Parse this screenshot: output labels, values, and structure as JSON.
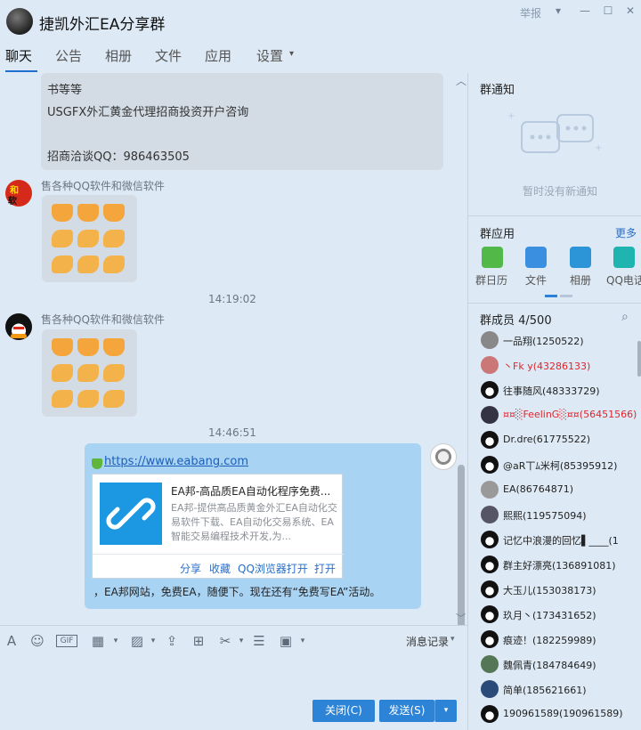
{
  "window": {
    "title": "捷凯外汇EA分享群",
    "report": "举报"
  },
  "tabs": [
    "聊天",
    "公告",
    "相册",
    "文件",
    "应用",
    "设置"
  ],
  "messages": {
    "first_bubble_lines": [
      "书等等",
      "USGFX外汇黄金代理招商投资开户咨询",
      "",
      "招商洽谈QQ：986463505"
    ],
    "sender1": "售各种QQ软件和微信软件",
    "time1": "14:19:02",
    "sender2": "售各种QQ软件和微信软件",
    "time2": "14:46:51",
    "link": "https://www.eabang.com",
    "card_title": "EA邦-高品质EA自动化程序免费...",
    "card_desc": "EA邦-提供高品质黄金外汇EA自动化交易软件下载、EA自动化交易系统、EA智能交易编程技术开发,为...",
    "card_actions": [
      "分享",
      "收藏",
      "QQ浏览器打开",
      "打开"
    ],
    "bubble_text": "，EA邦网站，免费EA，随便下。现在还有“免费写EA”活动。"
  },
  "toolbar": {
    "history": "消息记录"
  },
  "buttons": {
    "close": "关闭(C)",
    "send": "发送(S)"
  },
  "side": {
    "notice_title": "群通知",
    "notice_empty": "暂时没有新通知",
    "apps_title": "群应用",
    "apps_more": "更多",
    "apps": [
      "群日历",
      "文件",
      "相册",
      "QQ电话"
    ],
    "members_title": "群成员 4/500",
    "members": [
      {
        "name": "一品翔(1250522)",
        "red": false
      },
      {
        "name": "丶Fk y(43286133)",
        "red": true
      },
      {
        "name": "往事随风(48333729)",
        "red": false
      },
      {
        "name": "¤¤░FeelinG░¤¤(56451566)",
        "red": true
      },
      {
        "name": "Dr.dre(61775522)",
        "red": false
      },
      {
        "name": "@aR丅ﾑ米柯(85395912)",
        "red": false
      },
      {
        "name": "EA(86764871)",
        "red": false
      },
      {
        "name": "熙熙(119575094)",
        "red": false
      },
      {
        "name": "记忆中浪漫的回忆▌____(1",
        "red": false
      },
      {
        "name": "群主好漂亮(136891081)",
        "red": false
      },
      {
        "name": "大玉儿(153038173)",
        "red": false
      },
      {
        "name": "玖月丶(173431652)",
        "red": false
      },
      {
        "name": "痕迹！(182259989)",
        "red": false
      },
      {
        "name": "魏佩青(184784649)",
        "red": false
      },
      {
        "name": "简单(185621661)",
        "red": false
      },
      {
        "name": "190961589(190961589)",
        "red": false
      }
    ]
  }
}
